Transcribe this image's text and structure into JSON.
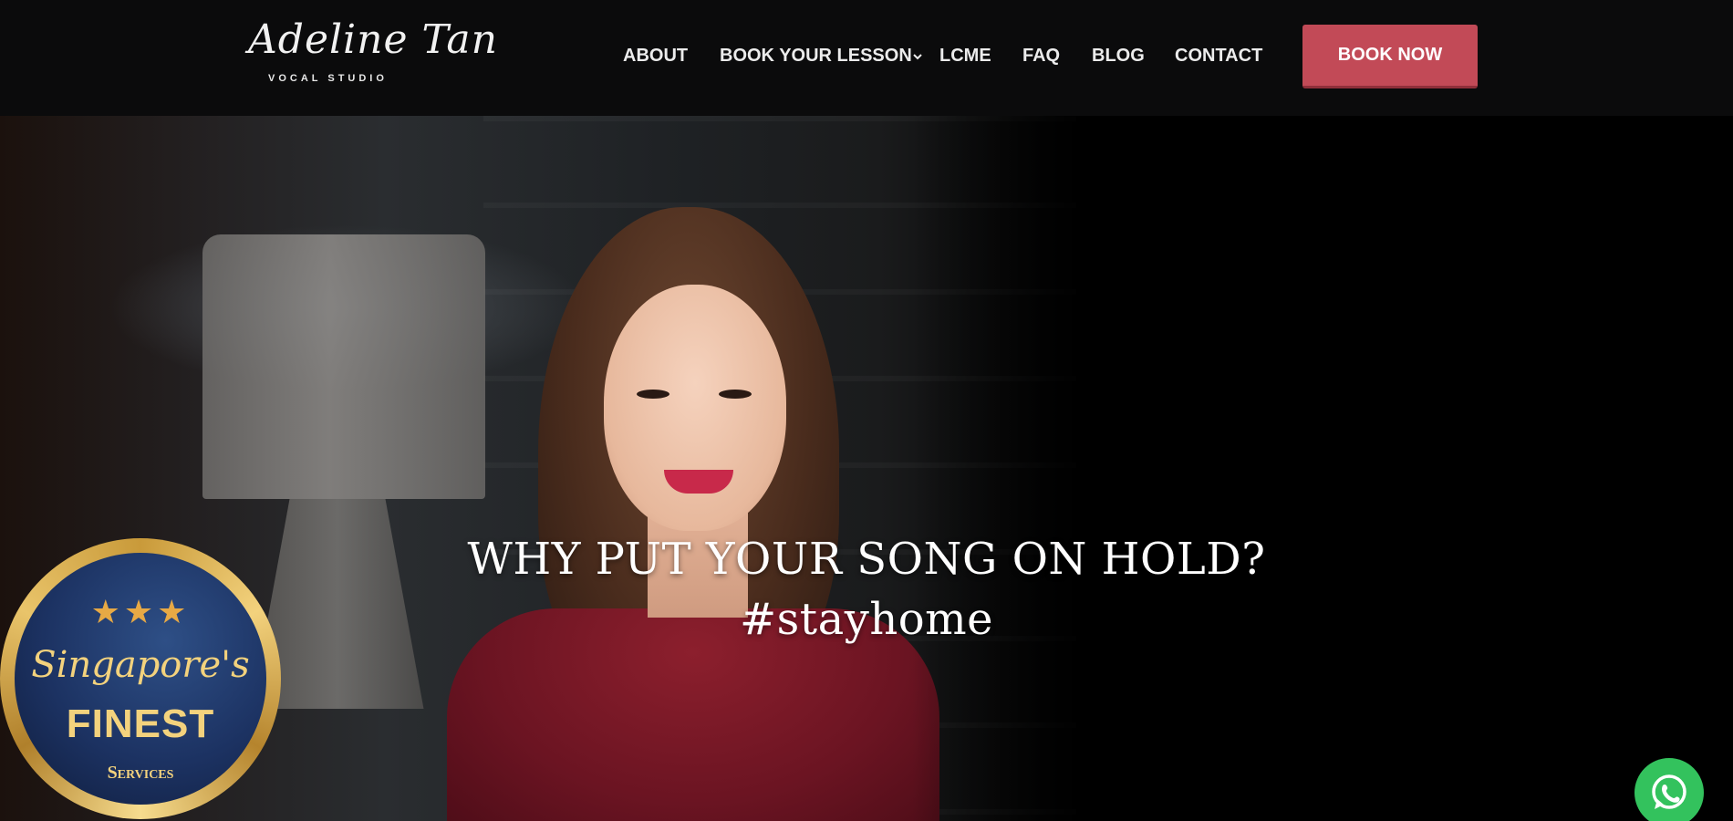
{
  "header": {
    "logo": {
      "script": "Adeline Tan",
      "sub": "VOCAL STUDIO"
    },
    "nav": [
      {
        "label": "ABOUT"
      },
      {
        "label": "BOOK YOUR LESSON"
      },
      {
        "label": "LCME"
      },
      {
        "label": "FAQ"
      },
      {
        "label": "BLOG"
      },
      {
        "label": "CONTACT"
      }
    ],
    "cta": "BOOK NOW",
    "cta_color": "#c24a57"
  },
  "hero": {
    "line1": "WHY PUT YOUR SONG ON HOLD?",
    "line2": "#stayhome"
  },
  "badge": {
    "stars": "★★★",
    "script": "Singapore's",
    "title": "FINEST",
    "subtitle": "Services"
  },
  "floating": {
    "icon": "whatsapp-icon",
    "color": "#33c25d"
  }
}
